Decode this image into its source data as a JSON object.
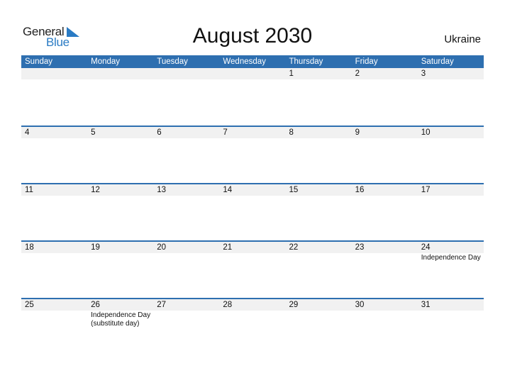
{
  "logo": {
    "general": "General",
    "blue": "Blue",
    "icon": "triangle-flag-icon",
    "brand_color": "#2a7bc4"
  },
  "title": "August 2030",
  "country": "Ukraine",
  "colors": {
    "header_bg": "#2e6fb0",
    "band_bg": "#f1f1f1"
  },
  "weekdays": [
    "Sunday",
    "Monday",
    "Tuesday",
    "Wednesday",
    "Thursday",
    "Friday",
    "Saturday"
  ],
  "weeks": [
    {
      "days": [
        {
          "n": ""
        },
        {
          "n": ""
        },
        {
          "n": ""
        },
        {
          "n": ""
        },
        {
          "n": "1"
        },
        {
          "n": "2"
        },
        {
          "n": "3"
        }
      ]
    },
    {
      "days": [
        {
          "n": "4"
        },
        {
          "n": "5"
        },
        {
          "n": "6"
        },
        {
          "n": "7"
        },
        {
          "n": "8"
        },
        {
          "n": "9"
        },
        {
          "n": "10"
        }
      ]
    },
    {
      "days": [
        {
          "n": "11"
        },
        {
          "n": "12"
        },
        {
          "n": "13"
        },
        {
          "n": "14"
        },
        {
          "n": "15"
        },
        {
          "n": "16"
        },
        {
          "n": "17"
        }
      ]
    },
    {
      "days": [
        {
          "n": "18"
        },
        {
          "n": "19"
        },
        {
          "n": "20"
        },
        {
          "n": "21"
        },
        {
          "n": "22"
        },
        {
          "n": "23"
        },
        {
          "n": "24",
          "events": [
            "Independence Day"
          ]
        }
      ]
    },
    {
      "days": [
        {
          "n": "25"
        },
        {
          "n": "26",
          "events": [
            "Independence Day",
            "(substitute day)"
          ]
        },
        {
          "n": "27"
        },
        {
          "n": "28"
        },
        {
          "n": "29"
        },
        {
          "n": "30"
        },
        {
          "n": "31"
        }
      ]
    }
  ]
}
